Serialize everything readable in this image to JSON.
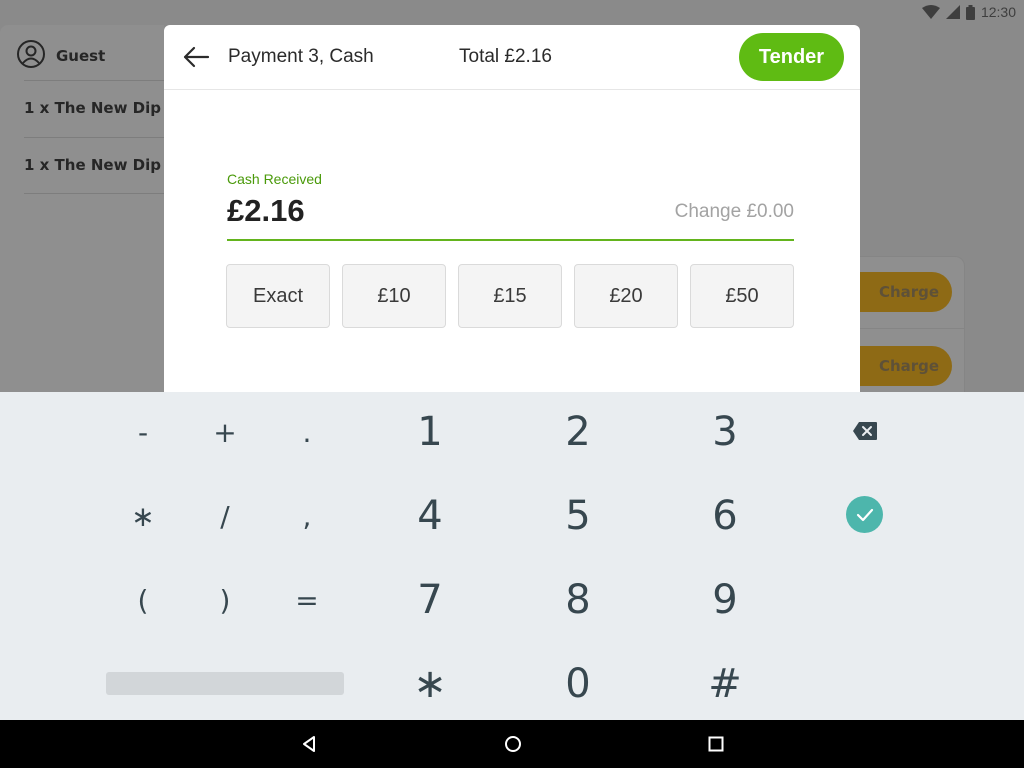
{
  "status_bar": {
    "time": "12:30",
    "icons": [
      "wifi-icon",
      "signal-icon",
      "battery-icon"
    ]
  },
  "background": {
    "guest_label": "Guest",
    "order_lines": [
      "1 x The New Dip",
      "1 x The New Dip"
    ],
    "charge_buttons": [
      "Charge",
      "Charge"
    ]
  },
  "modal": {
    "title": "Payment 3, Cash",
    "total": "Total £2.16",
    "tender_label": "Tender",
    "cash_label": "Cash Received",
    "cash_value": "£2.16",
    "change_text": "Change £0.00",
    "quick_amounts": [
      "Exact",
      "£10",
      "£15",
      "£20",
      "£50"
    ]
  },
  "keyboard": {
    "symbols": [
      "-",
      "+",
      ".",
      "∗",
      "/",
      ",",
      "(",
      ")",
      "="
    ],
    "digits": [
      "1",
      "2",
      "3",
      "4",
      "5",
      "6",
      "7",
      "8",
      "9",
      "∗",
      "0",
      "#"
    ],
    "enter_icon": "check-icon",
    "backspace_icon": "backspace-icon"
  },
  "colors": {
    "accent_green": "#5fbb13",
    "label_green": "#4a9a0a",
    "enter_teal": "#4db6ac",
    "charge_gold": "#8e6a15"
  }
}
